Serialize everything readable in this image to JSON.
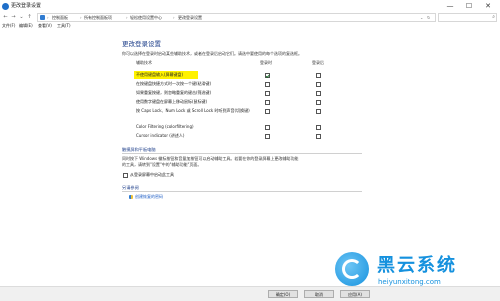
{
  "window": {
    "title": "更改登录设置"
  },
  "window_controls": {
    "minimize": "—",
    "maximize": "☐",
    "close": "✕"
  },
  "nav": {
    "back": "←",
    "forward": "→",
    "down": "⌄",
    "up": "↑"
  },
  "address_bar": {
    "crumbs": [
      "控制面板",
      "所有控制面板项",
      "轻松使用设置中心",
      "更改登录设置"
    ],
    "arrow": "›",
    "dropdown": "⌄",
    "refresh": "↻"
  },
  "search": {
    "icon": "⌕"
  },
  "menu": {
    "items": [
      "文件(F)",
      "编辑(E)",
      "查看(V)",
      "工具(T)"
    ]
  },
  "content": {
    "title": "更改登录设置",
    "description": "你可以选择在登录时启动某些辅助技术，或者在登录后启动它们。请选中要使用的每个选项的复选框。",
    "columns": {
      "tech": "辅助技术",
      "at_logon": "登录时",
      "after_logon": "登录后"
    },
    "rows": [
      {
        "label": "不使用键盘输入(屏幕键盘)",
        "at_logon": true,
        "after_logon": false,
        "highlighted": true
      },
      {
        "label": "在按键盘快捷方式时一次按一个键(粘滞键)",
        "at_logon": false,
        "after_logon": false
      },
      {
        "label": "如果重复按键，则忽略重复的键击(筛选键)",
        "at_logon": false,
        "after_logon": false
      },
      {
        "label": "使用数字键盘在屏幕上移动鼠标(鼠标键)",
        "at_logon": false,
        "after_logon": false
      },
      {
        "label": "按 Caps Lock、Num Lock 或 Scroll Lock 时听到声音(切换键)",
        "at_logon": false,
        "after_logon": false
      },
      {
        "label": "Color Filtering (colorfiltering)",
        "at_logon": false,
        "after_logon": false
      },
      {
        "label": "Cursor indicator (讲述人)",
        "at_logon": false,
        "after_logon": false
      }
    ]
  },
  "touch_section": {
    "title": "触摸屏和平板电脑",
    "text_line1": "同时按下 Windows 徽标按钮和音量加按钮可以启动辅助工具。若要在你的登录屏幕上更改辅助功能",
    "text_line2": "的工具，请转到\"设置\"中的\"辅助功能\"页面。",
    "checkbox_label": "从登录屏幕中启动此工具",
    "checked": false
  },
  "related_section": {
    "title": "另请参阅",
    "link": "创建恢复的密码"
  },
  "footer": {
    "ok": "确定(O)",
    "cancel": "取消",
    "apply": "应用(A)"
  },
  "watermark": {
    "text_cn": "黑云系统",
    "text_en": "heiyunxitong.com"
  }
}
